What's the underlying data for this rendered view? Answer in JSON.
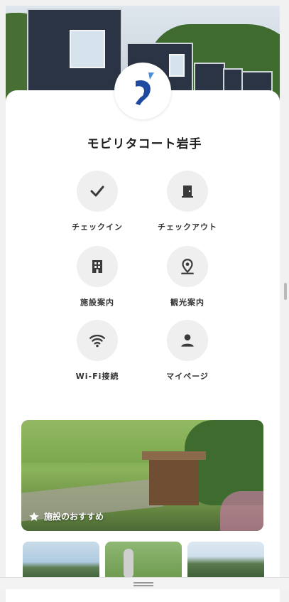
{
  "header": {
    "hero_image": "cabins-in-forest-photo",
    "logo": "facility-logo"
  },
  "facility": {
    "name": "モビリタコート岩手"
  },
  "menu": [
    {
      "label": "チェックイン",
      "icon": "check-icon"
    },
    {
      "label": "チェックアウト",
      "icon": "door-icon"
    },
    {
      "label": "施設案内",
      "icon": "building-icon"
    },
    {
      "label": "観光案内",
      "icon": "map-pin-icon"
    },
    {
      "label": "Wi-Fi接続",
      "icon": "wifi-icon"
    },
    {
      "label": "マイページ",
      "icon": "person-icon"
    }
  ],
  "feature": {
    "icon": "star-icon",
    "caption": "施設のおすすめ"
  },
  "thumbnails": [
    "landscape-thumbnail",
    "rabbit-statue-thumbnail",
    "mountain-thumbnail"
  ],
  "colors": {
    "accent_blue": "#1f4aa0",
    "light_blue": "#4d8fd6",
    "icon_gray": "#3a3a3a",
    "circle_bg": "#efefef"
  }
}
